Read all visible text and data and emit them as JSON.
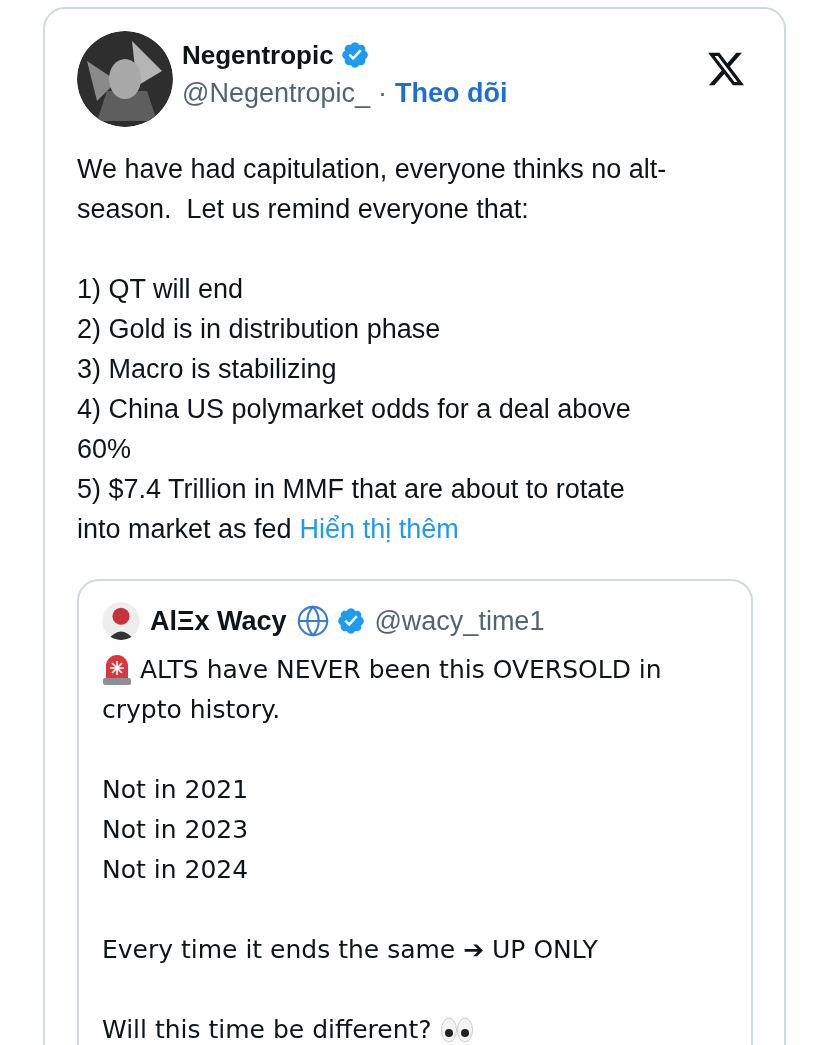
{
  "tweet": {
    "author": {
      "name": "Negentropic",
      "verified": true,
      "handle": "@Negentropic_",
      "separator": "·",
      "follow": "Theo dõi"
    },
    "paragraphs": [
      [
        "We have had capitulation, everyone thinks no alt-",
        "season.  Let us remind everyone that:"
      ],
      [
        "1) QT will end",
        "2) Gold is in distribution phase",
        "3) Macro is stabilizing",
        "4) China US polymarket odds for a deal above",
        "60%",
        "5) $7.4 Trillion in MMF that are about to rotate",
        "into market as fed"
      ]
    ],
    "more_link": "Hiển thị thêm",
    "quote": {
      "author": {
        "name": "AlΞx Wacy",
        "verified": true,
        "handle": "@wacy_time1"
      },
      "paragraphs": [
        {
          "lines": [
            "ALTS have NEVER been this OVERSOLD in",
            "crypto history."
          ],
          "siren": true
        },
        {
          "lines": [
            "Not in 2021",
            "Not in 2023",
            "Not in 2024"
          ]
        },
        {
          "lines": [
            "Every time it ends the same ➔ UP ONLY"
          ]
        },
        {
          "lines": [
            "Will this time be different?"
          ],
          "eyes": true
        }
      ]
    }
  }
}
